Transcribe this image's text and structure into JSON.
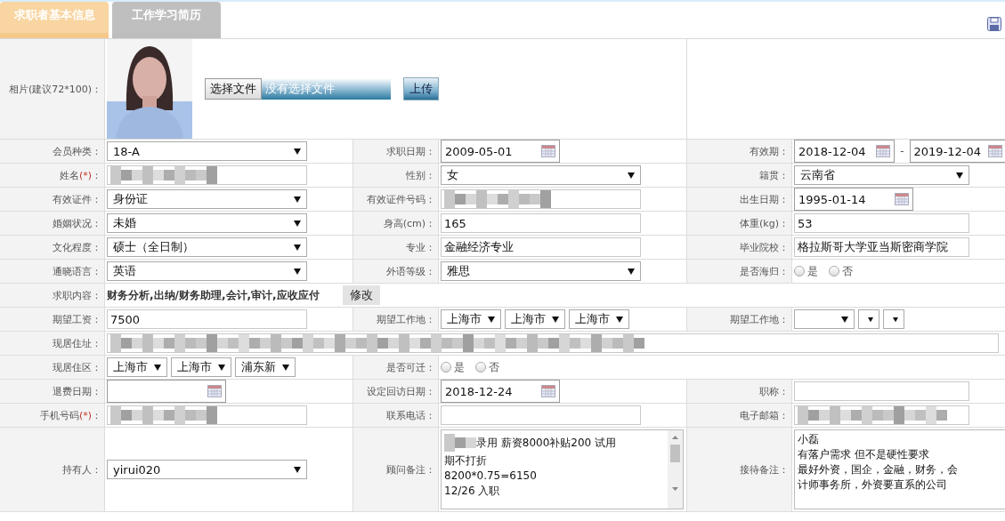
{
  "tabs": [
    {
      "label": "求职者基本信息",
      "selected": true
    },
    {
      "label": "工作学习简历",
      "selected": false
    }
  ],
  "rows": [
    {
      "cells": [
        {
          "kind": "label",
          "text": "相片(建议72*100)："
        },
        {
          "choose_label": "选择文件",
          "file_status": "没有选择文件",
          "upload_label": "上传"
        }
      ]
    },
    {
      "cells": [
        {
          "kind": "label",
          "text": "会员种类："
        },
        {
          "kind": "select",
          "value": "18-A"
        },
        {
          "kind": "label",
          "text": "求职日期："
        },
        {
          "kind": "date",
          "value": "2009-05-01"
        },
        {
          "kind": "label",
          "text": "有效期："
        },
        {
          "kind": "date_range",
          "from": "2018-12-04",
          "sep": "-",
          "to": "2019-12-04"
        }
      ]
    },
    {
      "cells": [
        {
          "kind": "label",
          "text": "姓名",
          "mark": "(*)",
          "tail": "："
        },
        {
          "kind": "redacted"
        },
        {
          "kind": "label",
          "text": "性别："
        },
        {
          "kind": "select",
          "value": "女"
        },
        {
          "kind": "label",
          "text": "籍贯："
        },
        {
          "kind": "select",
          "value": "云南省"
        }
      ]
    },
    {
      "cells": [
        {
          "kind": "label",
          "text": "有效证件："
        },
        {
          "kind": "select",
          "value": "身份证"
        },
        {
          "kind": "label",
          "text": "有效证件号码："
        },
        {
          "kind": "redacted"
        },
        {
          "kind": "label",
          "text": "出生日期："
        },
        {
          "kind": "date",
          "value": "1995-01-14"
        }
      ]
    },
    {
      "cells": [
        {
          "kind": "label",
          "text": "婚姻状况："
        },
        {
          "kind": "select",
          "value": "未婚"
        },
        {
          "kind": "label",
          "text": "身高(cm)："
        },
        {
          "kind": "text",
          "value": "165"
        },
        {
          "kind": "label",
          "text": "体重(kg)："
        },
        {
          "kind": "text",
          "value": "53"
        }
      ]
    },
    {
      "cells": [
        {
          "kind": "label",
          "text": "文化程度："
        },
        {
          "kind": "select",
          "value": "硕士（全日制）"
        },
        {
          "kind": "label",
          "text": "专业："
        },
        {
          "kind": "text",
          "value": "金融经济专业"
        },
        {
          "kind": "label",
          "text": "毕业院校："
        },
        {
          "kind": "text",
          "value": "格拉斯哥大学亚当斯密商学院"
        }
      ]
    },
    {
      "cells": [
        {
          "kind": "label",
          "text": "通晓语言："
        },
        {
          "kind": "select",
          "value": "英语"
        },
        {
          "kind": "label",
          "text": "外语等级："
        },
        {
          "kind": "select",
          "value": "雅思"
        },
        {
          "kind": "label",
          "text": "是否海归："
        },
        {
          "kind": "radio",
          "options": [
            {
              "label": "是",
              "selected": false
            },
            {
              "label": "否",
              "selected": false
            }
          ]
        }
      ]
    },
    {
      "cells": [
        {
          "kind": "label",
          "text": "求职内容："
        },
        {
          "kind": "tags",
          "text": "财务分析,出纳/财务助理,会计,审计,应收应付",
          "button": "修改"
        }
      ]
    },
    {
      "cells": [
        {
          "kind": "label",
          "text": "期望工资："
        },
        {
          "kind": "text",
          "value": "7500"
        },
        {
          "kind": "label",
          "text": "期望工作地："
        },
        {
          "kind": "select_group",
          "items": [
            {
              "value": "上海市"
            },
            {
              "value": "上海市"
            },
            {
              "value": "上海市"
            }
          ]
        },
        {
          "kind": "label",
          "text": "期望工作地："
        },
        {
          "kind": "select_group",
          "items": [
            {
              "kind": "blank"
            },
            {
              "kind": "blank"
            },
            {
              "kind": "blank"
            }
          ]
        }
      ]
    },
    {
      "cells": [
        {
          "kind": "label",
          "text": "现居住址："
        },
        {
          "kind": "redacted_wide"
        }
      ]
    },
    {
      "cells": [
        {
          "kind": "label",
          "text": "现居住区："
        },
        {
          "kind": "select_group",
          "items": [
            {
              "value": "上海市"
            },
            {
              "value": "上海市"
            },
            {
              "value": "浦东新"
            }
          ]
        },
        {
          "kind": "label",
          "text": "是否可迁："
        },
        {
          "kind": "radio",
          "options": [
            {
              "label": "是",
              "selected": false
            },
            {
              "label": "否",
              "selected": false
            }
          ]
        }
      ]
    },
    {
      "cells": [
        {
          "kind": "label",
          "text": "退费日期："
        },
        {
          "kind": "date"
        },
        {
          "kind": "label",
          "text": "设定回访日期："
        },
        {
          "kind": "date",
          "value": "2018-12-24"
        },
        {
          "kind": "label",
          "text": "职称："
        },
        {
          "kind": "text"
        }
      ]
    },
    {
      "cells": [
        {
          "kind": "label",
          "text": "手机号码",
          "mark": "(*)",
          "tail": "："
        },
        {
          "kind": "redacted"
        },
        {
          "kind": "label",
          "text": "联系电话："
        },
        {
          "kind": "text"
        },
        {
          "kind": "label",
          "text": "电子邮箱："
        },
        {
          "kind": "redacted"
        }
      ]
    },
    {
      "cells": [
        {
          "kind": "label",
          "text": "持有人："
        },
        {
          "kind": "select",
          "value": "yirui020"
        },
        {
          "kind": "label",
          "text": "顾问备注："
        },
        {
          "kind": "notes",
          "scrollbar": true,
          "redacted_start": true,
          "lines": [
            "录用 薪资8000补贴200 试用",
            "期不打折",
            "8200*0.75=6150",
            "12/26 入职"
          ]
        },
        {
          "kind": "label",
          "text": "接待备注："
        },
        {
          "kind": "notes",
          "scrollbar": false,
          "redacted_start": false,
          "lines": [
            "小磊",
            "有落户需求  但不是硬性要求",
            "最好外资，国企，金融，财务，会",
            "计师事务所，外资要直系的公司"
          ]
        }
      ]
    }
  ]
}
